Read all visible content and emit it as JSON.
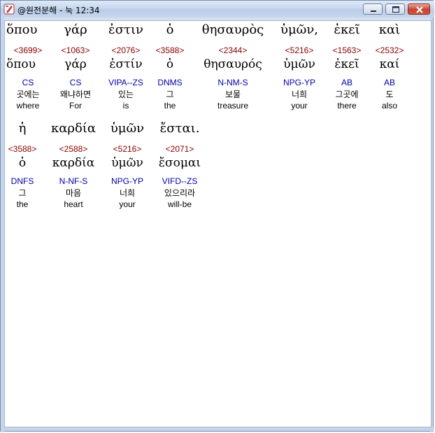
{
  "window": {
    "title": "@원전분해 - 눅 12:34",
    "min_icon": "minimize-icon",
    "max_icon": "maximize-icon",
    "close_icon": "close-icon"
  },
  "rows": [
    {
      "words": [
        {
          "greek": "ὅπου",
          "strong": "<3699>",
          "lemma": "ὅπου",
          "parse": "CS",
          "korean": "곳에는",
          "english": "where"
        },
        {
          "greek": "γάρ",
          "strong": "<1063>",
          "lemma": "γάρ",
          "parse": "CS",
          "korean": "왜냐하면",
          "english": "For"
        },
        {
          "greek": "ἐστιν",
          "strong": "<2076>",
          "lemma": "ἐστίν",
          "parse": "VIPA--ZS",
          "korean": "있는",
          "english": "is"
        },
        {
          "greek": "ὁ",
          "strong": "<3588>",
          "lemma": "ὁ",
          "parse": "DNMS",
          "korean": "그",
          "english": "the"
        },
        {
          "greek": "θησαυρὸς",
          "strong": "<2344>",
          "lemma": "θησαυρός",
          "parse": "N-NM-S",
          "korean": "보물",
          "english": "treasure"
        },
        {
          "greek": "ὑμῶν,",
          "strong": "<5216>",
          "lemma": "ὑμῶν",
          "parse": "NPG-YP",
          "korean": "너희",
          "english": "your"
        },
        {
          "greek": "ἐκεῖ",
          "strong": "<1563>",
          "lemma": "ἐκεῖ",
          "parse": "AB",
          "korean": "그곳에",
          "english": "there"
        },
        {
          "greek": "καὶ",
          "strong": "<2532>",
          "lemma": "καί",
          "parse": "AB",
          "korean": "도",
          "english": "also"
        }
      ]
    },
    {
      "words": [
        {
          "greek": "ἡ",
          "strong": "<3588>",
          "lemma": "ὁ",
          "parse": "DNFS",
          "korean": "그",
          "english": "the"
        },
        {
          "greek": "καρδία",
          "strong": "<2588>",
          "lemma": "καρδία",
          "parse": "N-NF-S",
          "korean": "마음",
          "english": "heart"
        },
        {
          "greek": "ὑμῶν",
          "strong": "<5216>",
          "lemma": "ὑμῶν",
          "parse": "NPG-YP",
          "korean": "너희",
          "english": "your"
        },
        {
          "greek": "ἔσται.",
          "strong": "<2071>",
          "lemma": "ἔσομαι",
          "parse": "VIFD--ZS",
          "korean": "있으리라",
          "english": "will-be"
        }
      ]
    }
  ]
}
